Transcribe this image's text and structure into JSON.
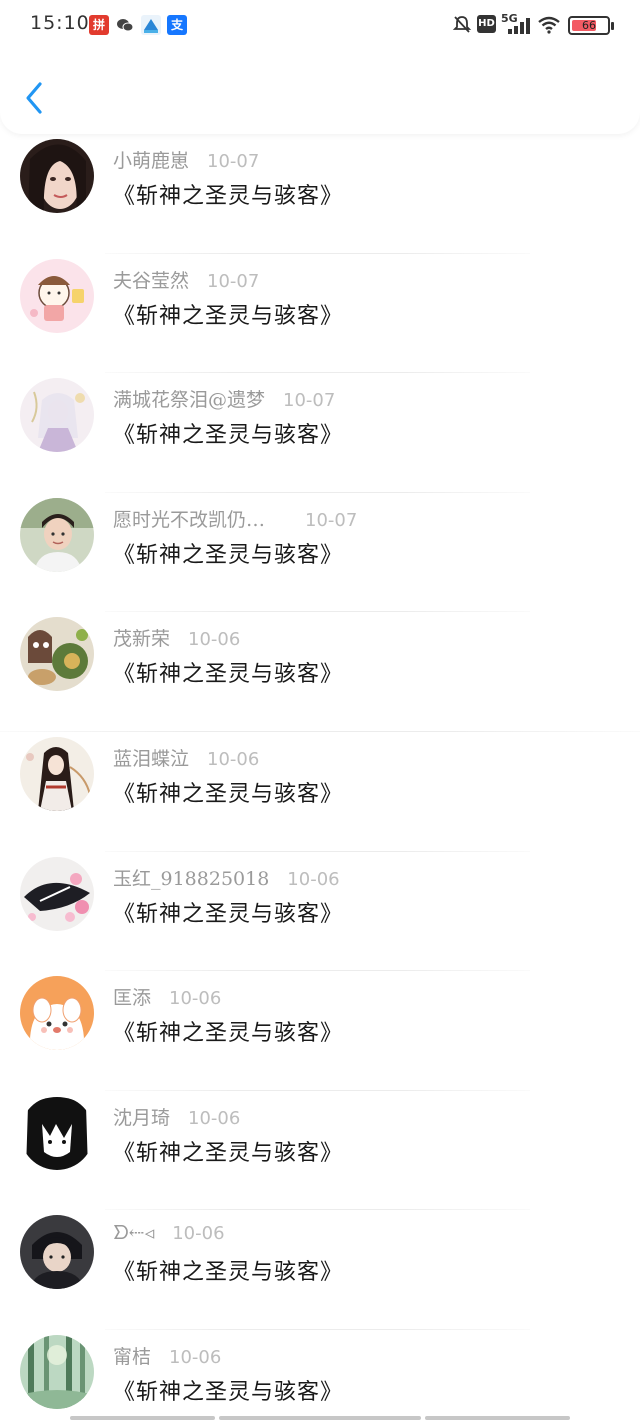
{
  "status_bar": {
    "time": "15:10",
    "network": "5G",
    "hd": "HD",
    "battery_percent": "66",
    "app_icons": [
      "pinduoduo-icon",
      "wechat-icon",
      "app-icon",
      "alipay-icon"
    ]
  },
  "colors": {
    "accent": "#2196f3",
    "battery": "#f35b64"
  },
  "list": [
    {
      "name": "小萌鹿崽",
      "date": "10-07",
      "title": "《斩神之圣灵与骇客》",
      "avatar": "avatar-girl-photo"
    },
    {
      "name": "夫谷莹然",
      "date": "10-07",
      "title": "《斩神之圣灵与骇客》",
      "avatar": "avatar-cartoon-pink"
    },
    {
      "name": "满城花祭泪@遗梦",
      "date": "10-07",
      "title": "《斩神之圣灵与骇客》",
      "avatar": "avatar-anime-white"
    },
    {
      "name": "愿时光不改凯仍…",
      "date": "10-07",
      "title": "《斩神之圣灵与骇客》",
      "avatar": "avatar-boy-photo"
    },
    {
      "name": "茂新荣",
      "date": "10-06",
      "title": "《斩神之圣灵与骇客》",
      "avatar": "avatar-food"
    },
    {
      "name": "蓝泪蝶泣",
      "date": "10-06",
      "title": "《斩神之圣灵与骇客》",
      "avatar": "avatar-anime-girl"
    },
    {
      "name": "玉红_918825018",
      "date": "10-06",
      "title": "《斩神之圣灵与骇客》",
      "avatar": "avatar-flowers"
    },
    {
      "name": "匡添",
      "date": "10-06",
      "title": "《斩神之圣灵与骇客》",
      "avatar": "avatar-cartoon-dog"
    },
    {
      "name": "沈月琦",
      "date": "10-06",
      "title": "《斩神之圣灵与骇客》",
      "avatar": "avatar-manga"
    },
    {
      "name": "ᗤ⇠◃",
      "date": "10-06",
      "title": "《斩神之圣灵与骇客》",
      "avatar": "avatar-anime-dark"
    },
    {
      "name": "甯桔",
      "date": "10-06",
      "title": "《斩神之圣灵与骇客》",
      "avatar": "avatar-forest"
    }
  ]
}
